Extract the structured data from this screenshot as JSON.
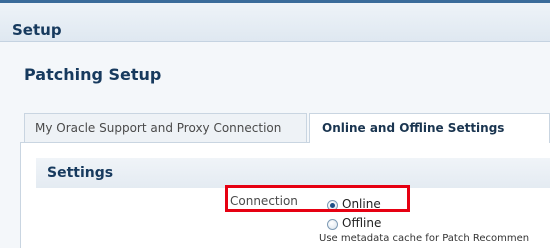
{
  "header": {
    "title": "Setup"
  },
  "page": {
    "title": "Patching Setup"
  },
  "tabs": [
    {
      "label": "My Oracle Support and Proxy Connection",
      "selected": false
    },
    {
      "label": "Online and Offline Settings",
      "selected": true
    }
  ],
  "settings": {
    "title": "Settings",
    "connection_label": "Connection",
    "options": [
      {
        "label": "Online",
        "selected": true
      },
      {
        "label": "Offline",
        "selected": false
      }
    ],
    "hint": "Use metadata cache for Patch Recommen"
  },
  "colors": {
    "highlight": "#e60012",
    "title": "#173a5e",
    "accent": "#3a6b9a"
  }
}
